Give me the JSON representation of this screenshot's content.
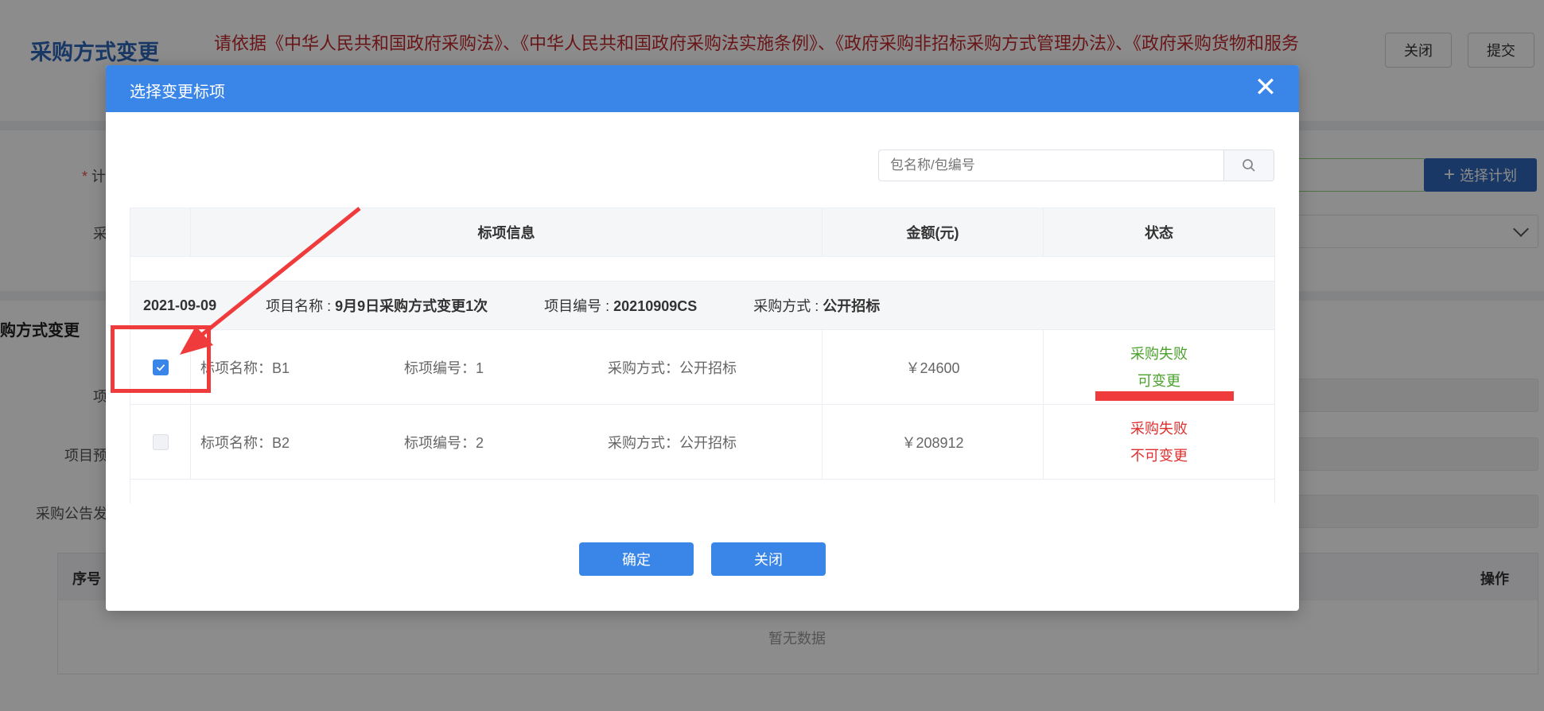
{
  "page": {
    "title": "采购方式变更",
    "notice_line1": "请依据《中华人民共和国政府采购法》、《中华人民共和国政府采购法实施条例》、《政府采购非招标采购方式管理办法》、《政府采购货物和服务",
    "close_label": "关闭",
    "submit_label": "提交",
    "plan_label_char": "计",
    "caigou_label_char": "采",
    "select_plan_label": "选择计划",
    "section_title": "购方式变更",
    "xiang_label": "项",
    "project_yu_label": "项目预",
    "notice_date_label": "采购公告发",
    "table_col_index": "序号",
    "table_col_action": "操作",
    "no_data": "暂无数据"
  },
  "modal": {
    "title": "选择变更标项",
    "search_placeholder": "包名称/包编号",
    "columns": {
      "info": "标项信息",
      "amount": "金额(元)",
      "status": "状态"
    },
    "group": {
      "date": "2021-09-09",
      "project_name_label": "项目名称 : ",
      "project_name": "9月9日采购方式变更1次",
      "project_no_label": "项目编号 : ",
      "project_no": "20210909CS",
      "method_label": "采购方式 : ",
      "method": "公开招标"
    },
    "rows": [
      {
        "name": "标项名称：B1",
        "no": "标项编号：1",
        "method": "采购方式：公开招标",
        "amount": "￥24600",
        "status1": "采购失败",
        "status2": "可变更",
        "checked": true
      },
      {
        "name": "标项名称：B2",
        "no": "标项编号：2",
        "method": "采购方式：公开招标",
        "amount": "￥208912",
        "status1": "采购失败",
        "status2": "不可变更",
        "checked": false
      }
    ],
    "confirm_label": "确定",
    "close_label": "关闭"
  },
  "colors": {
    "accent": "#3a86e8",
    "ok": "#4aa12c",
    "bad": "#e02f2f",
    "annotation": "#ef3b3b"
  }
}
